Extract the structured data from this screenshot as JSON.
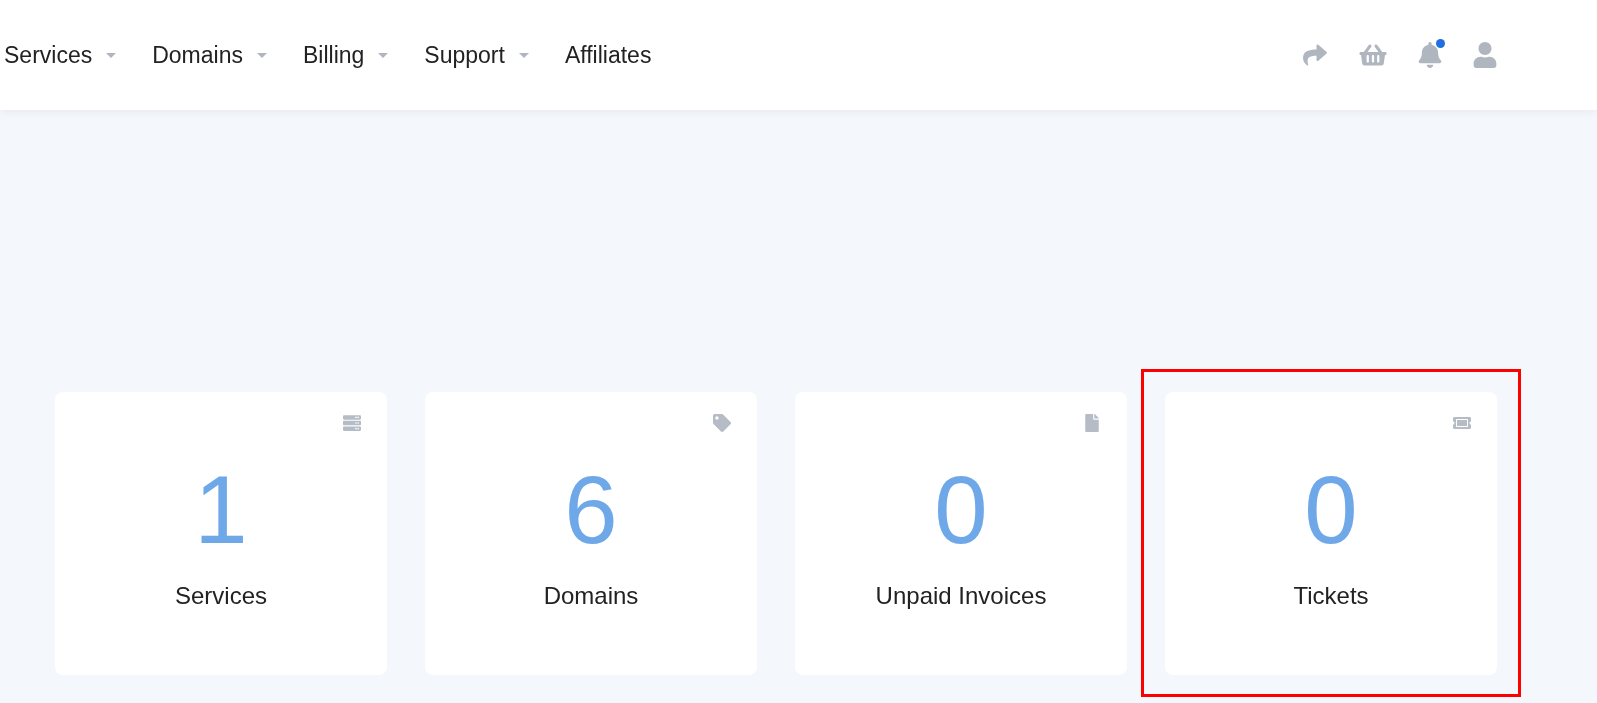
{
  "nav": {
    "items": [
      {
        "label": "Services",
        "dropdown": true
      },
      {
        "label": "Domains",
        "dropdown": true
      },
      {
        "label": "Billing",
        "dropdown": true
      },
      {
        "label": "Support",
        "dropdown": true
      },
      {
        "label": "Affiliates",
        "dropdown": false
      }
    ],
    "icons": [
      {
        "kind": "share"
      },
      {
        "kind": "cart"
      },
      {
        "kind": "bell",
        "unread": true
      },
      {
        "kind": "user"
      }
    ]
  },
  "stats": [
    {
      "kind": "services",
      "count": "1",
      "label": "Services",
      "highlighted": false
    },
    {
      "kind": "domains",
      "count": "6",
      "label": "Domains",
      "highlighted": false
    },
    {
      "kind": "invoices",
      "count": "0",
      "label": "Unpaid Invoices",
      "highlighted": false
    },
    {
      "kind": "tickets",
      "count": "0",
      "label": "Tickets",
      "highlighted": true
    }
  ]
}
